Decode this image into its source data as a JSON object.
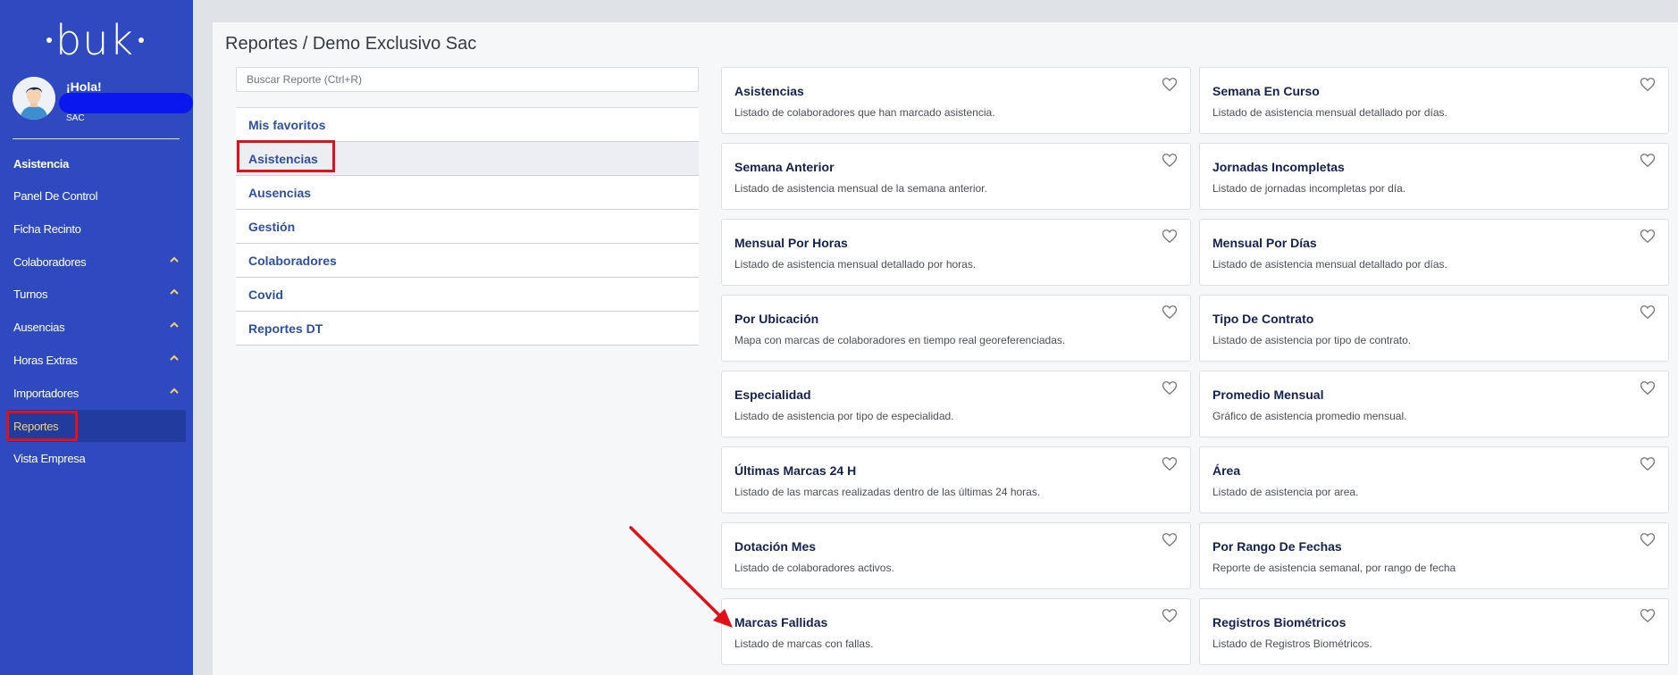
{
  "brand": {
    "logo_text": "buk"
  },
  "user": {
    "greeting": "¡Hola!",
    "role": "SAC"
  },
  "sidebar": {
    "items": [
      {
        "label": "Asistencia",
        "bold": true
      },
      {
        "label": "Panel De Control"
      },
      {
        "label": "Ficha Recinto"
      },
      {
        "label": "Colaboradores",
        "expandable": true
      },
      {
        "label": "Turnos",
        "expandable": true
      },
      {
        "label": "Ausencias",
        "expandable": true
      },
      {
        "label": "Horas Extras",
        "expandable": true
      },
      {
        "label": "Importadores",
        "expandable": true
      },
      {
        "label": "Reportes",
        "active": true
      },
      {
        "label": "Vista Empresa"
      }
    ]
  },
  "page": {
    "title": "Reportes / Demo Exclusivo Sac"
  },
  "search": {
    "placeholder": "Buscar Reporte (Ctrl+R)"
  },
  "categories": [
    {
      "label": "Mis favoritos"
    },
    {
      "label": "Asistencias",
      "selected": true
    },
    {
      "label": "Ausencias"
    },
    {
      "label": "Gestión"
    },
    {
      "label": "Colaboradores"
    },
    {
      "label": "Covid"
    },
    {
      "label": "Reportes DT"
    }
  ],
  "reports": [
    {
      "title": "Asistencias",
      "desc": "Listado de colaboradores que han marcado asistencia."
    },
    {
      "title": "Semana En Curso",
      "desc": "Listado de asistencia mensual detallado por días."
    },
    {
      "title": "Semana Anterior",
      "desc": "Listado de asistencia mensual de la semana anterior."
    },
    {
      "title": "Jornadas Incompletas",
      "desc": "Listado de jornadas incompletas por día."
    },
    {
      "title": "Mensual Por Horas",
      "desc": "Listado de asistencia mensual detallado por horas."
    },
    {
      "title": "Mensual Por Días",
      "desc": "Listado de asistencia mensual detallado por días."
    },
    {
      "title": "Por Ubicación",
      "desc": "Mapa con marcas de colaboradores en tiempo real georeferenciadas."
    },
    {
      "title": "Tipo De Contrato",
      "desc": "Listado de asistencia por tipo de contrato."
    },
    {
      "title": "Especialidad",
      "desc": "Listado de asistencia por tipo de especialidad."
    },
    {
      "title": "Promedio Mensual",
      "desc": "Gráfico de asistencia promedio mensual."
    },
    {
      "title": "Últimas Marcas 24 H",
      "desc": "Listado de las marcas realizadas dentro de las últimas 24 horas."
    },
    {
      "title": "Área",
      "desc": "Listado de asistencia por area."
    },
    {
      "title": "Dotación Mes",
      "desc": "Listado de colaboradores activos."
    },
    {
      "title": "Por Rango De Fechas",
      "desc": "Reporte de asistencia semanal, por rango de fecha"
    },
    {
      "title": "Marcas Fallidas",
      "desc": "Listado de marcas con fallas."
    },
    {
      "title": "Registros Biométricos",
      "desc": "Listado de Registros Biométricos."
    }
  ],
  "colors": {
    "sidebar_bg": "#2f4ac0",
    "active_item_text": "#f2d173",
    "category_text": "#2f4ea8",
    "annotation_red": "#e3101a"
  },
  "icons": {
    "favorite": "heart-outline-icon",
    "expand": "chevron-up-icon"
  }
}
